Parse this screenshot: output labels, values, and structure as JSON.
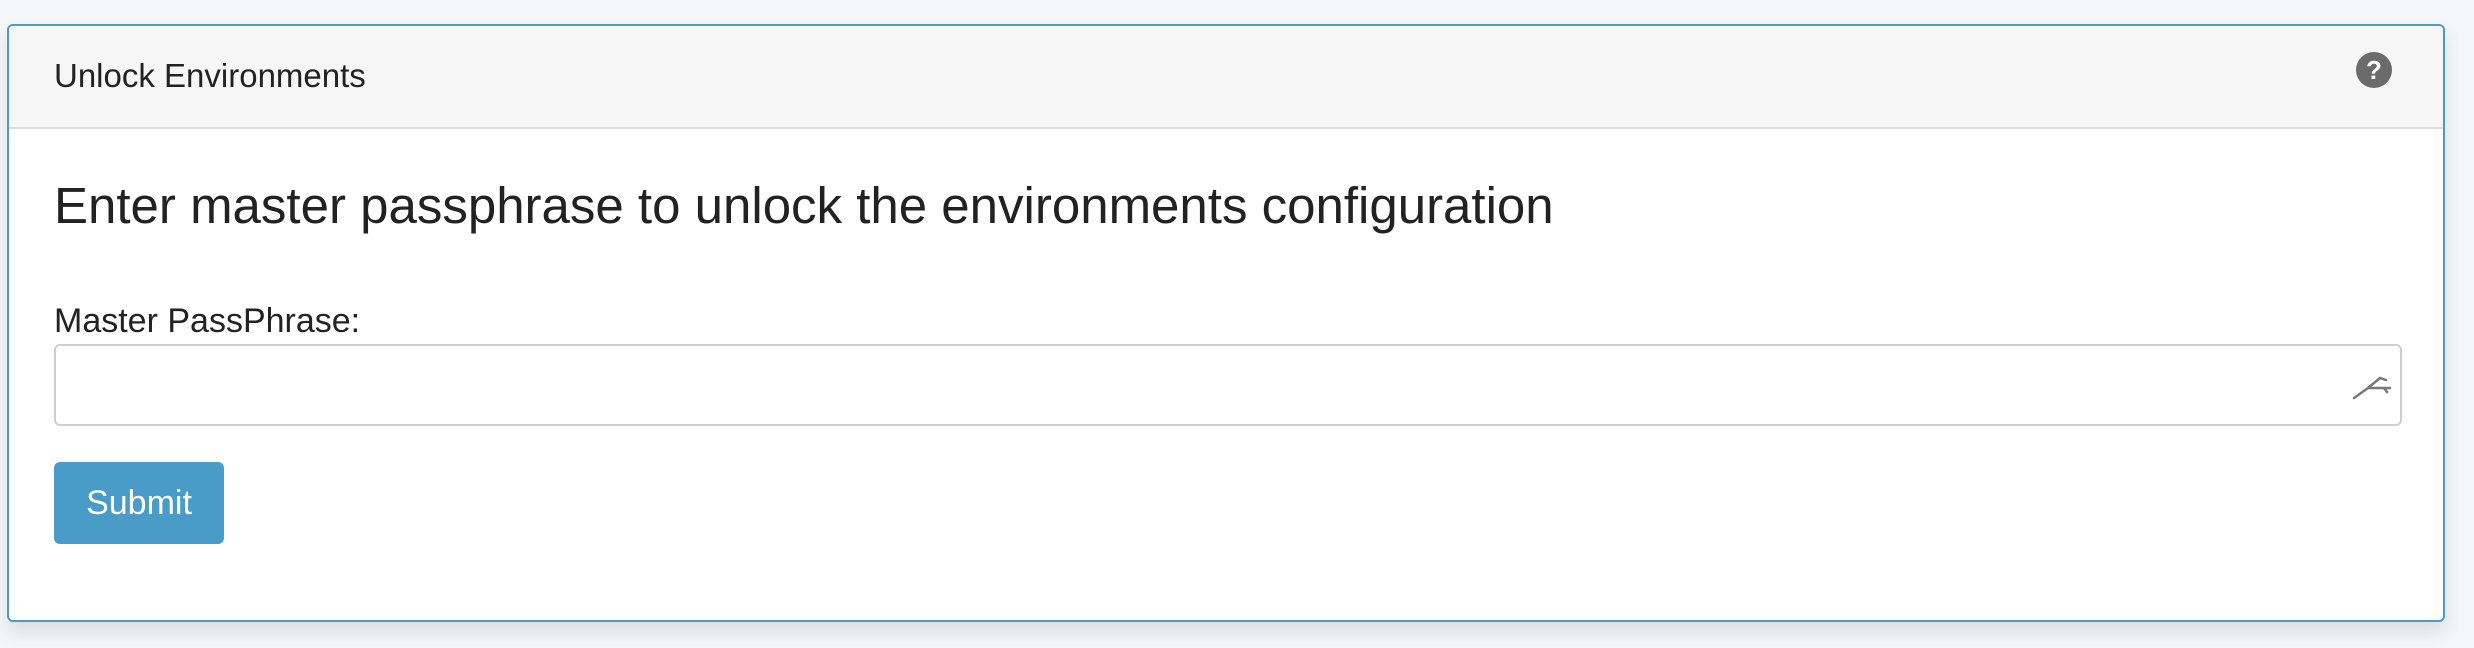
{
  "panel": {
    "title": "Unlock Environments",
    "help_icon": "question-circle-icon",
    "help_glyph": "?"
  },
  "form": {
    "heading": "Enter master passphrase to unlock the environments configuration",
    "field_label": "Master PassPhrase:",
    "passphrase_value": "",
    "passphrase_placeholder": "",
    "field_icon": "key-icon",
    "submit_label": "Submit"
  },
  "colors": {
    "accent": "#4a9cc8",
    "panel_border": "#4a9cc2",
    "header_bg": "#f6f6f6"
  }
}
